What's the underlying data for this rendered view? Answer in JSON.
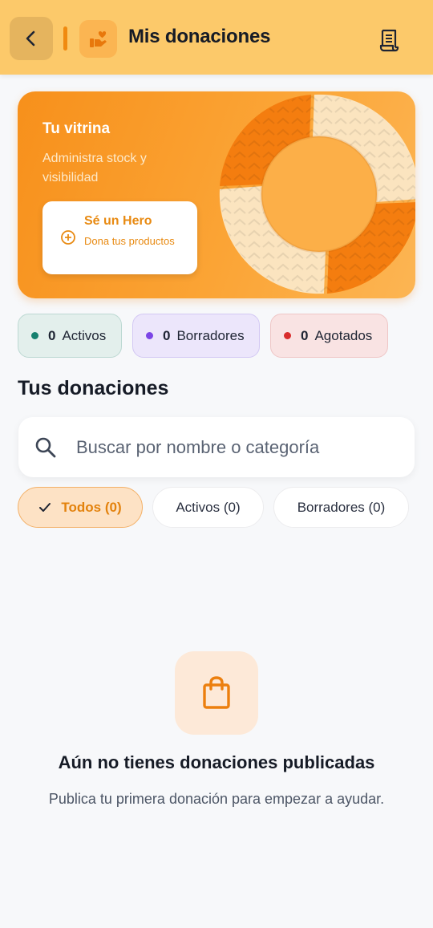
{
  "header": {
    "title": "Mis donaciones",
    "back_icon": "chevron-left-icon",
    "logo_icon": "hand-heart-icon",
    "action_icon": "receipt-icon",
    "accent": "#f08a10",
    "background": "#fcc96a"
  },
  "banner": {
    "title": "Tu vitrina",
    "subtitle": "Administra stock y visibilidad",
    "hero_card": {
      "title": "Sé un Hero",
      "subtitle": "Dona tus productos",
      "icon": "plus-circle-icon"
    },
    "illustration": "lifebuoy-icon"
  },
  "status_chips": [
    {
      "count": "0",
      "label": "Activos",
      "color": "#16806f"
    },
    {
      "count": "0",
      "label": "Borradores",
      "color": "#7b45e6"
    },
    {
      "count": "0",
      "label": "Agotados",
      "color": "#d92d2d"
    }
  ],
  "section_title": "Tus donaciones",
  "search": {
    "placeholder": "Buscar por nombre o categoría",
    "value": "",
    "icon": "search-icon"
  },
  "filters": [
    {
      "label": "Todos (0)",
      "selected": true
    },
    {
      "label": "Activos (0)",
      "selected": false
    },
    {
      "label": "Borradores (0)",
      "selected": false
    }
  ],
  "empty_state": {
    "icon": "shopping-bag-icon",
    "title": "Aún no tienes donaciones publicadas",
    "subtitle": "Publica tu primera donación para empezar a ayudar."
  }
}
